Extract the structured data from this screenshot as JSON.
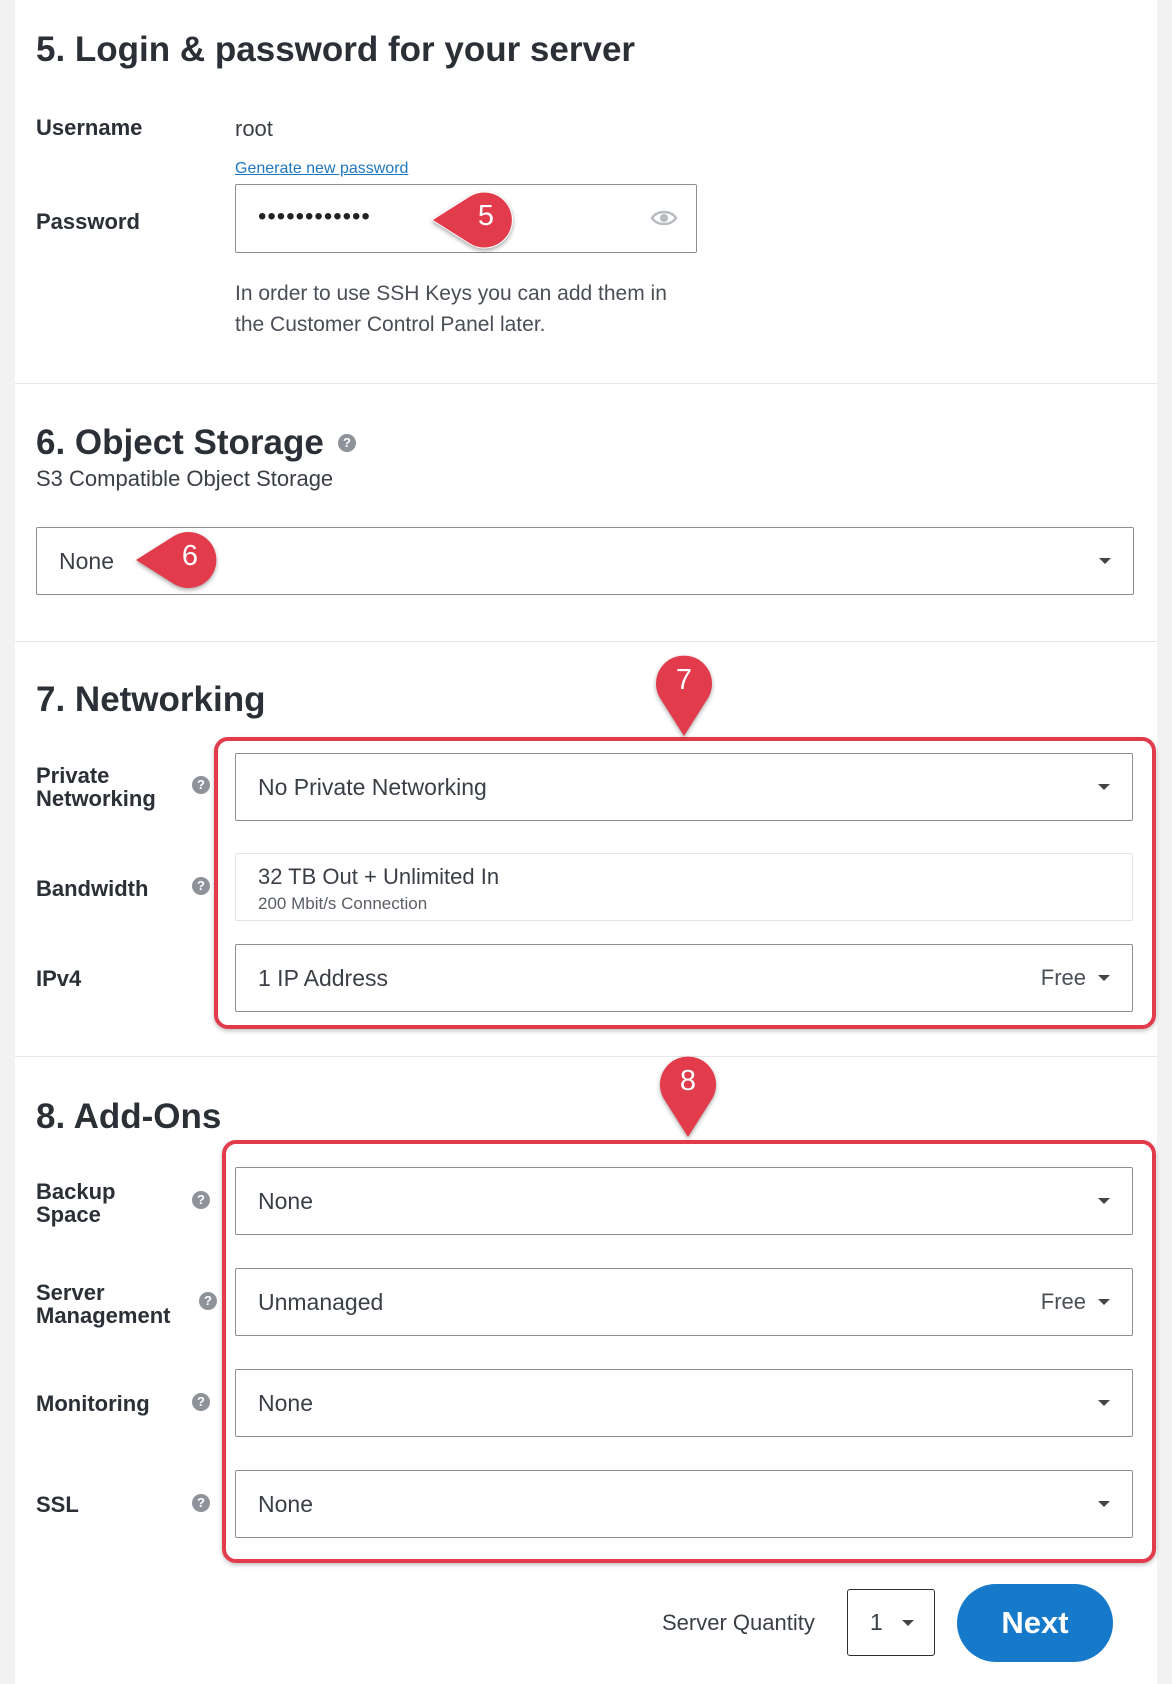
{
  "login": {
    "heading": "5. Login & password for your server",
    "username_label": "Username",
    "username_value": "root",
    "generate_link": "Generate new password",
    "password_label": "Password",
    "password_value": "••••••••••••",
    "ssh_note_line1": "In order to use SSH Keys you can add them in",
    "ssh_note_line2": "the Customer Control Panel later."
  },
  "object_storage": {
    "heading": "6. Object Storage",
    "subtitle": "S3 Compatible Object Storage",
    "selected": "None"
  },
  "networking": {
    "heading": "7. Networking",
    "private_label_line1": "Private",
    "private_label_line2": "Networking",
    "private_value": "No Private Networking",
    "bandwidth_label": "Bandwidth",
    "bandwidth_value": "32 TB Out + Unlimited In",
    "bandwidth_sub": "200 Mbit/s Connection",
    "ipv4_label": "IPv4",
    "ipv4_value": "1 IP Address",
    "ipv4_price": "Free"
  },
  "addons": {
    "heading": "8. Add-Ons",
    "backup_label_line1": "Backup",
    "backup_label_line2": "Space",
    "backup_value": "None",
    "mgmt_label_line1": "Server",
    "mgmt_label_line2": "Management",
    "mgmt_value": "Unmanaged",
    "mgmt_price": "Free",
    "monitoring_label": "Monitoring",
    "monitoring_value": "None",
    "ssl_label": "SSL",
    "ssl_value": "None"
  },
  "footer": {
    "quantity_label": "Server Quantity",
    "quantity_value": "1",
    "next_label": "Next"
  },
  "help_glyph": "?",
  "callouts": {
    "c5": "5",
    "c6": "6",
    "c7": "7",
    "c8": "8"
  },
  "colors": {
    "callout_red": "#e23b4b",
    "next_blue": "#1679c9",
    "link_blue": "#1f78c1"
  }
}
